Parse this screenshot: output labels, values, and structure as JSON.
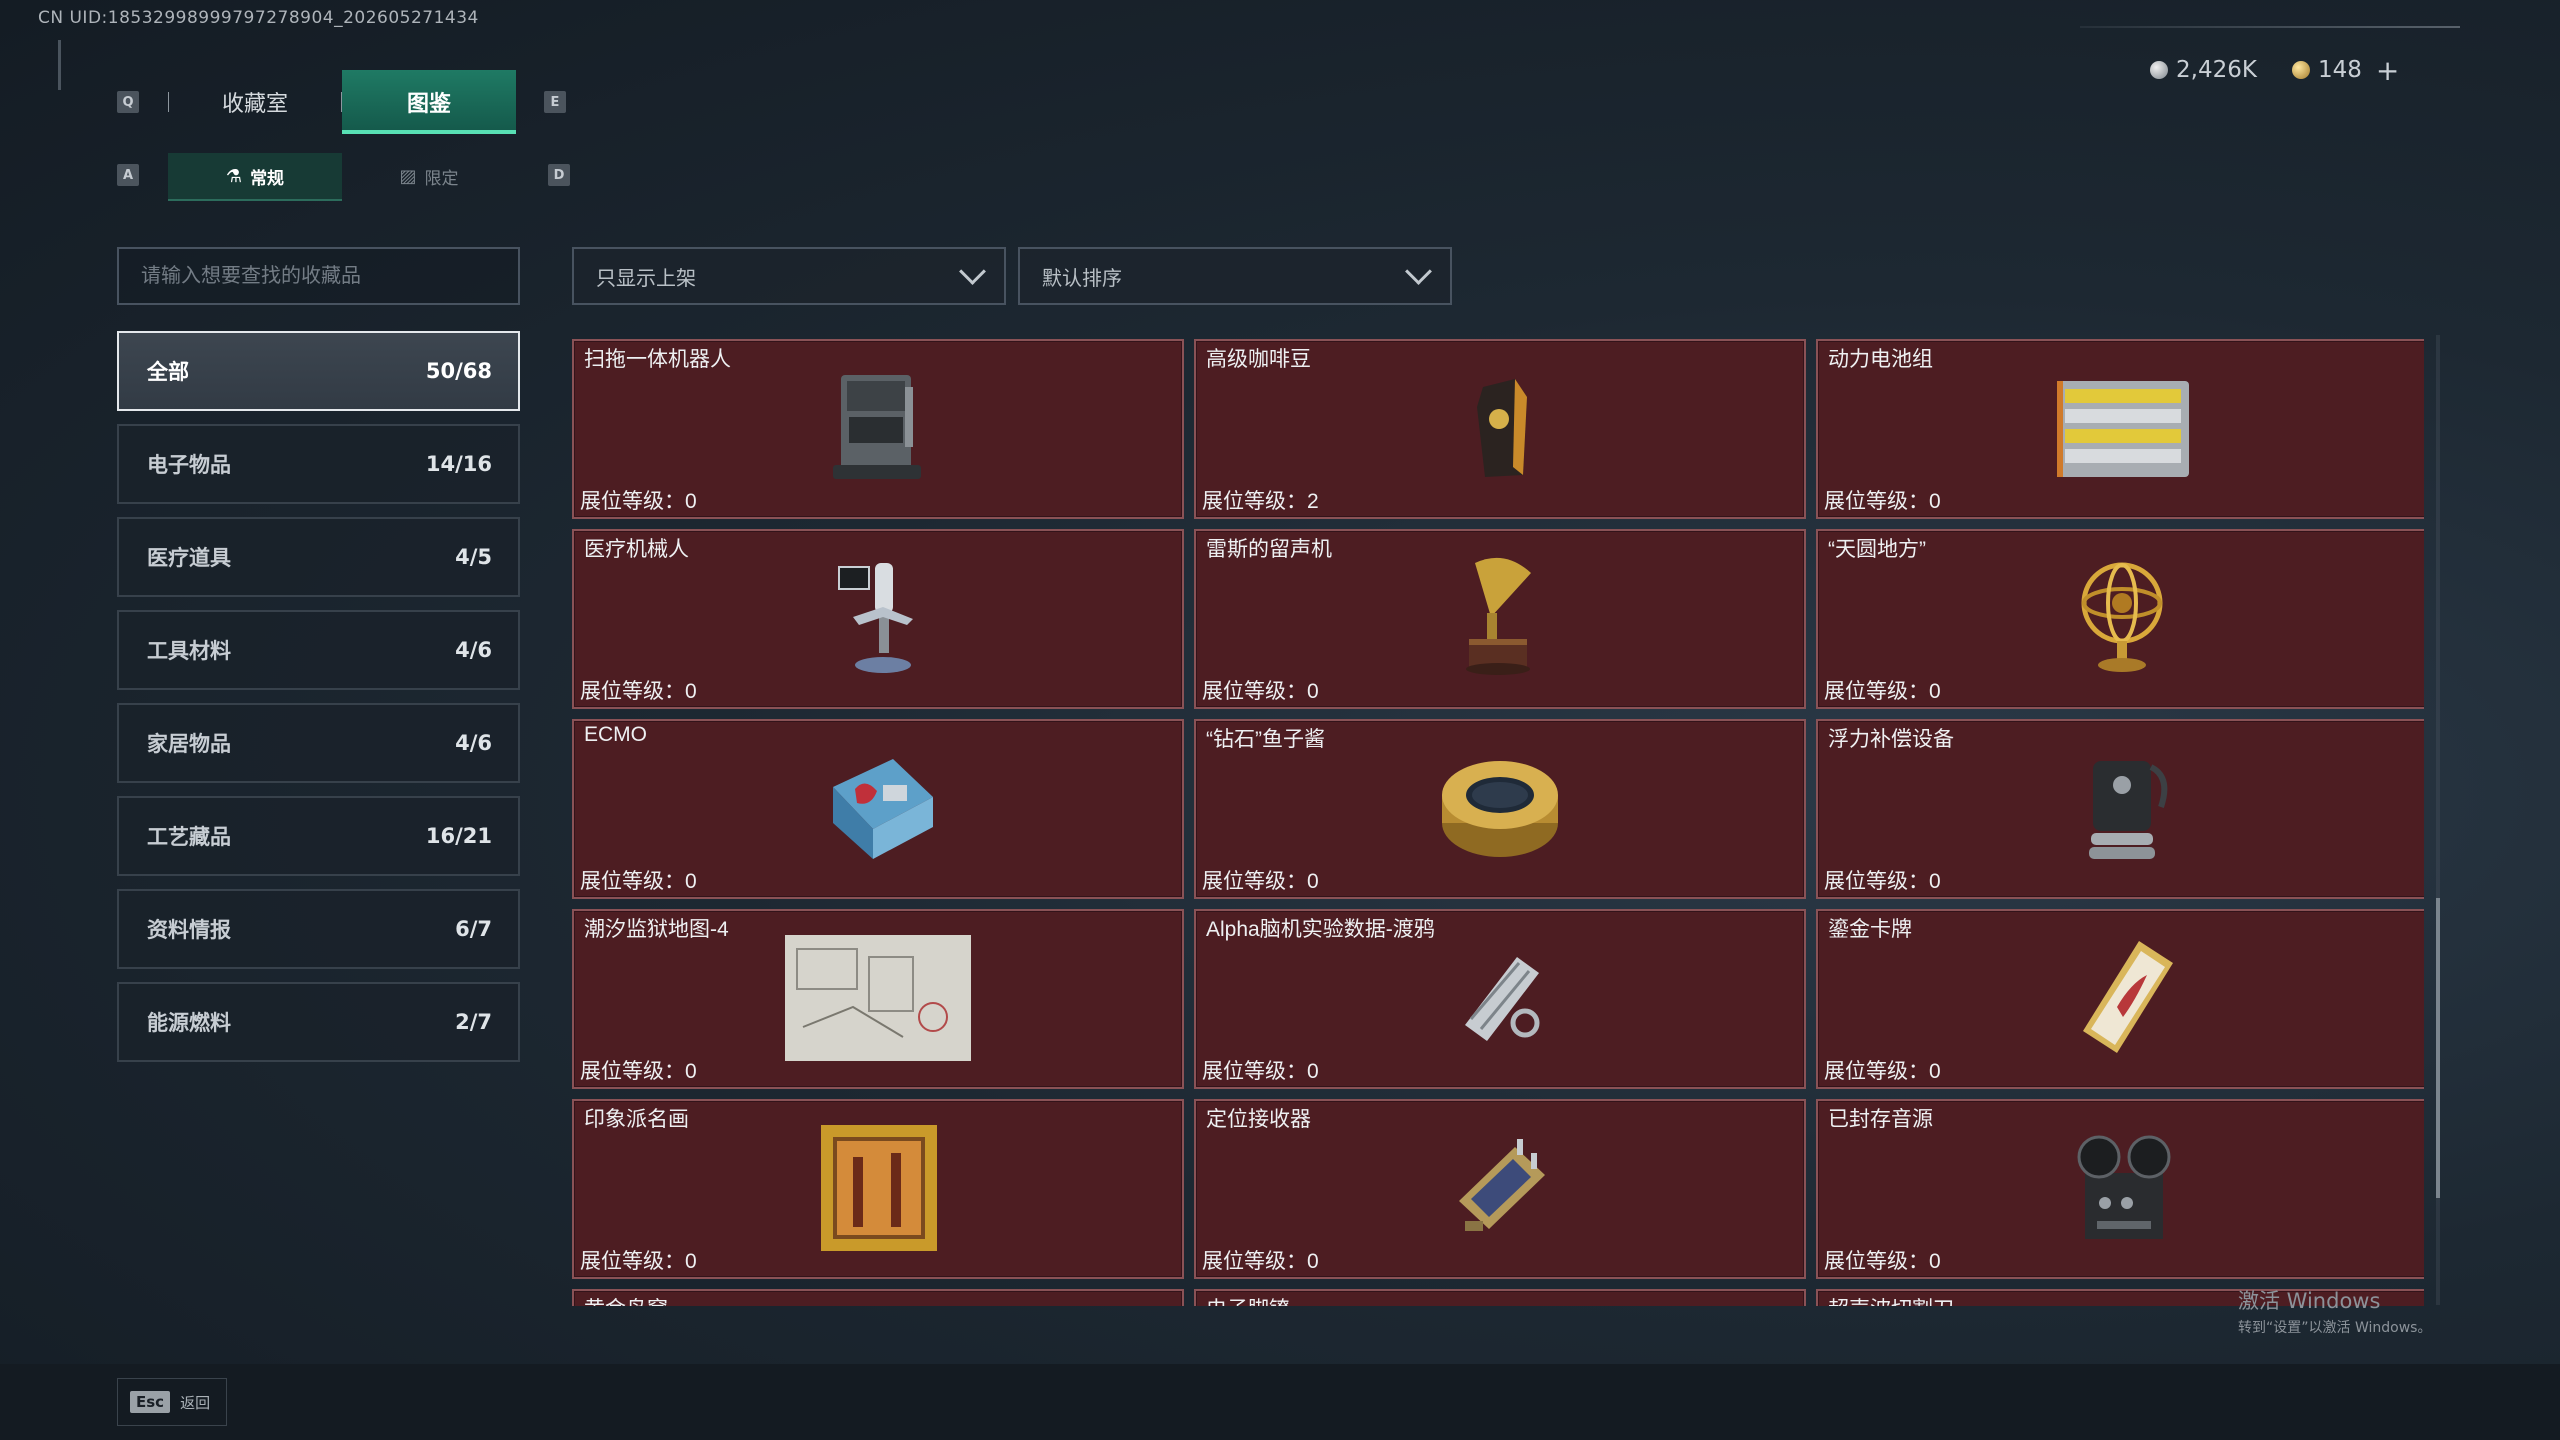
{
  "uid": "CN UID:18532998999797278904_202605271434",
  "currency": {
    "silver": "2,426K",
    "gold": "148",
    "plus": "+"
  },
  "keys": {
    "prev_tab": "Q",
    "next_tab": "E",
    "prev_sub": "A",
    "next_sub": "D"
  },
  "tabs": [
    {
      "label": "收藏室",
      "active": false
    },
    {
      "label": "图鉴",
      "active": true
    }
  ],
  "subtabs": [
    {
      "label": "常规",
      "active": true
    },
    {
      "label": "限定",
      "active": false
    }
  ],
  "search": {
    "placeholder": "请输入想要查找的收藏品"
  },
  "filters": {
    "shelf": "只显示上架",
    "sort": "默认排序"
  },
  "categories": [
    {
      "name": "全部",
      "count": "50/68",
      "active": true
    },
    {
      "name": "电子物品",
      "count": "14/16"
    },
    {
      "name": "医疗道具",
      "count": "4/5"
    },
    {
      "name": "工具材料",
      "count": "4/6"
    },
    {
      "name": "家居物品",
      "count": "4/6"
    },
    {
      "name": "工艺藏品",
      "count": "16/21"
    },
    {
      "name": "资料情报",
      "count": "6/7"
    },
    {
      "name": "能源燃料",
      "count": "2/7"
    }
  ],
  "level_label": "展位等级：",
  "items": [
    {
      "name": "扫拖一体机器人",
      "level": "0",
      "icon": "robot-vacuum-icon"
    },
    {
      "name": "高级咖啡豆",
      "level": "2",
      "icon": "coffee-bag-icon"
    },
    {
      "name": "动力电池组",
      "level": "0",
      "icon": "battery-pack-icon"
    },
    {
      "name": "医疗机械人",
      "level": "0",
      "icon": "medical-robot-icon"
    },
    {
      "name": "雷斯的留声机",
      "level": "0",
      "icon": "gramophone-icon"
    },
    {
      "name": "“天圆地方”",
      "level": "0",
      "icon": "armillary-sphere-icon"
    },
    {
      "name": "ECMO",
      "level": "0",
      "icon": "ecmo-machine-icon"
    },
    {
      "name": "“钻石”鱼子酱",
      "level": "0",
      "icon": "caviar-tin-icon"
    },
    {
      "name": "浮力补偿设备",
      "level": "0",
      "icon": "buoyancy-device-icon"
    },
    {
      "name": "潮汐监狱地图-4",
      "level": "0",
      "icon": "map-document-icon"
    },
    {
      "name": "Alpha脑机实验数据-渡鸦",
      "level": "0",
      "icon": "data-drive-icon"
    },
    {
      "name": "鎏金卡牌",
      "level": "0",
      "icon": "gilded-card-icon"
    },
    {
      "name": "印象派名画",
      "level": "0",
      "icon": "framed-painting-icon"
    },
    {
      "name": "定位接收器",
      "level": "0",
      "icon": "receiver-device-icon"
    },
    {
      "name": "已封存音源",
      "level": "0",
      "icon": "reel-recorder-icon"
    },
    {
      "name": "黄金鸟窝",
      "level": "",
      "icon": ""
    },
    {
      "name": "电子脚镣",
      "level": "",
      "icon": ""
    },
    {
      "name": "超声波切割刀",
      "level": "",
      "icon": ""
    }
  ],
  "watermark": {
    "line1": "激活 Windows",
    "line2": "转到“设置”以激活 Windows。"
  },
  "footer": {
    "esc_key": "Esc",
    "back_label": "返回"
  },
  "colors": {
    "accent": "#1f7a64",
    "card_bg": "#4d1d22",
    "card_border": "#8a5256"
  }
}
